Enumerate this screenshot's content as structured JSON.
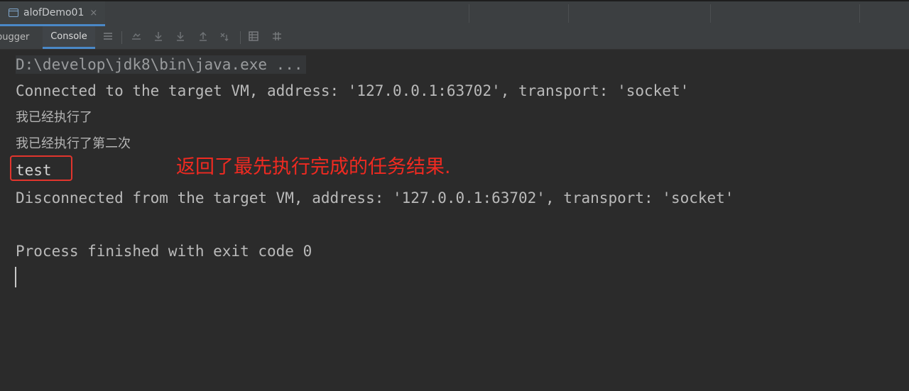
{
  "tabbar": {
    "tab_label": "alofDemo01",
    "close_glyph": "×",
    "icon": "window-icon"
  },
  "toolbar": {
    "debugger_label": "bugger",
    "console_label": "Console",
    "icons": [
      "menu-icon",
      "restore-layout-icon",
      "step-over-icon",
      "step-into-icon",
      "step-out-icon",
      "run-to-cursor-icon",
      "evaluate-icon",
      "threads-icon"
    ]
  },
  "console": {
    "lines": [
      "D:\\develop\\jdk8\\bin\\java.exe ...",
      "Connected to the target VM, address: '127.0.0.1:63702', transport: 'socket'",
      "我已经执行了",
      "我已经执行了第二次",
      "test",
      "Disconnected from the target VM, address: '127.0.0.1:63702', transport: 'socket'",
      "Process finished with exit code 0"
    ]
  },
  "annotation": {
    "text": "返回了最先执行完成的任务结果.",
    "color": "#f02a21"
  },
  "colors": {
    "background": "#2b2b2b",
    "accent": "#4a88c7",
    "annotation": "#e1352d"
  }
}
